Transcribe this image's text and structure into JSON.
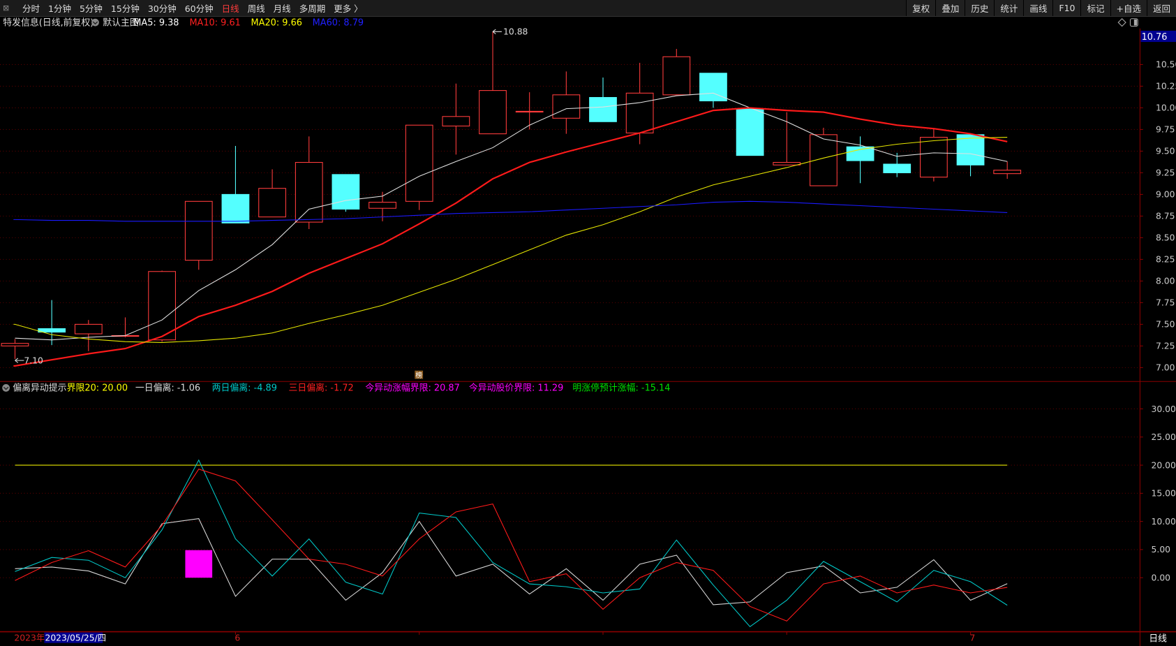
{
  "toolbar": {
    "collapse_icon": "panel-collapse-icon",
    "periods": [
      "分时",
      "1分钟",
      "5分钟",
      "15分钟",
      "30分钟",
      "60分钟",
      "日线",
      "周线",
      "月线",
      "多周期",
      "更多 〉"
    ],
    "active_period": "日线",
    "actions": [
      "复权",
      "叠加",
      "历史",
      "统计",
      "画线",
      "F10",
      "标记",
      "+自选",
      "返回"
    ]
  },
  "main_header": {
    "title": "特发信息(日线,前复权)",
    "selector_icon": "chevron-down-circle-icon",
    "template": "默认主图",
    "ma": [
      {
        "label": "MA5: 9.38",
        "color": "#ffffff"
      },
      {
        "label": "MA10: 9.61",
        "color": "#ff2020"
      },
      {
        "label": "MA20: 9.66",
        "color": "#ffff00"
      },
      {
        "label": "MA60: 8.79",
        "color": "#2020ff"
      }
    ],
    "right_icons": [
      "diamond-icon",
      "panel-toggle-icon"
    ]
  },
  "indicator_header": {
    "title": "偏离异动提示",
    "items": [
      {
        "label": "界限20: 20.00",
        "color": "#ffff00"
      },
      {
        "label": "一日偏离: -1.06",
        "color": "#dddddd"
      },
      {
        "label": "两日偏离: -4.89",
        "color": "#00c8c8"
      },
      {
        "label": "三日偏离: -1.72",
        "color": "#ff2020"
      },
      {
        "label": "今异动涨幅界限: 20.87",
        "color": "#ff00ff"
      },
      {
        "label": "今异动股价界限: 11.29",
        "color": "#ff00ff"
      },
      {
        "label": "明涨停预计涨幅: -15.14",
        "color": "#00e000"
      }
    ]
  },
  "date_bar": {
    "year": "2023年",
    "cursor_date": "2023/05/25/四",
    "month_labels": [
      "6",
      "7"
    ],
    "period": "日线"
  },
  "colors": {
    "up": "#ff3c3c",
    "down": "#54ffff",
    "ma5": "#e0e0e0",
    "ma10": "#ff1a1a",
    "ma20": "#e6e600",
    "ma60": "#1a1aff",
    "grid": "#5a0000",
    "border": "#8b0000",
    "cursor_bg": "#000090"
  },
  "chart_data": [
    {
      "type": "candlestick",
      "ylim": [
        6.9,
        10.9
      ],
      "yticks": [
        "7.00",
        "7.25",
        "7.50",
        "7.75",
        "8.00",
        "8.25",
        "8.50",
        "8.75",
        "9.00",
        "9.25",
        "9.50",
        "9.75",
        "10.00",
        "10.25",
        "10.50"
      ],
      "current_price_label": "10.76",
      "annotations": [
        {
          "label": "10.88",
          "type": "high"
        },
        {
          "label": "7.10",
          "type": "low"
        }
      ],
      "ohlc": [
        [
          7.25,
          7.33,
          7.1,
          7.28
        ],
        [
          7.45,
          7.78,
          7.26,
          7.41
        ],
        [
          7.39,
          7.55,
          7.19,
          7.5
        ],
        [
          7.37,
          7.58,
          7.35,
          7.37
        ],
        [
          7.32,
          8.12,
          7.3,
          8.11
        ],
        [
          8.24,
          8.92,
          8.13,
          8.92
        ],
        [
          9.0,
          9.56,
          8.67,
          8.67
        ],
        [
          8.74,
          9.29,
          8.74,
          9.07
        ],
        [
          8.68,
          9.67,
          8.6,
          9.37
        ],
        [
          9.23,
          9.23,
          8.8,
          8.83
        ],
        [
          8.84,
          9.03,
          8.69,
          8.91
        ],
        [
          8.92,
          9.8,
          8.82,
          9.8
        ],
        [
          9.79,
          10.28,
          9.46,
          9.9
        ],
        [
          9.7,
          10.88,
          9.7,
          10.2
        ],
        [
          9.96,
          10.18,
          9.75,
          9.96
        ],
        [
          9.88,
          10.42,
          9.7,
          10.15
        ],
        [
          10.12,
          10.35,
          9.84,
          9.84
        ],
        [
          9.71,
          10.52,
          9.58,
          10.17
        ],
        [
          10.15,
          10.68,
          10.15,
          10.59
        ],
        [
          10.4,
          10.4,
          10.0,
          10.08
        ],
        [
          9.99,
          10.0,
          9.45,
          9.45
        ],
        [
          9.34,
          9.95,
          9.34,
          9.37
        ],
        [
          9.1,
          9.77,
          9.1,
          9.69
        ],
        [
          9.55,
          9.67,
          9.13,
          9.39
        ],
        [
          9.35,
          9.48,
          9.2,
          9.25
        ],
        [
          9.2,
          9.76,
          9.15,
          9.66
        ],
        [
          9.69,
          9.7,
          9.21,
          9.34
        ],
        [
          9.24,
          9.38,
          9.18,
          9.28
        ]
      ],
      "series": [
        {
          "name": "MA5",
          "values": [
            7.34,
            7.32,
            7.35,
            7.37,
            7.55,
            7.89,
            8.13,
            8.42,
            8.83,
            8.93,
            8.98,
            9.21,
            9.38,
            9.54,
            9.8,
            9.99,
            10.01,
            10.06,
            10.14,
            10.17,
            10.0,
            9.84,
            9.64,
            9.57,
            9.44,
            9.48,
            9.47,
            9.38
          ]
        },
        {
          "name": "MA10",
          "values": [
            7.02,
            7.09,
            7.16,
            7.22,
            7.36,
            7.59,
            7.72,
            7.88,
            8.09,
            8.26,
            8.43,
            8.66,
            8.9,
            9.18,
            9.37,
            9.49,
            9.6,
            9.71,
            9.84,
            9.97,
            10.0,
            9.97,
            9.95,
            9.87,
            9.8,
            9.76,
            9.7,
            9.61
          ]
        },
        {
          "name": "MA20",
          "values": [
            7.5,
            7.38,
            7.33,
            7.3,
            7.29,
            7.31,
            7.34,
            7.4,
            7.51,
            7.61,
            7.72,
            7.87,
            8.02,
            8.19,
            8.36,
            8.53,
            8.65,
            8.8,
            8.97,
            9.11,
            9.21,
            9.31,
            9.42,
            9.52,
            9.58,
            9.62,
            9.65,
            9.66
          ]
        },
        {
          "name": "MA60",
          "values": [
            8.71,
            8.7,
            8.7,
            8.69,
            8.69,
            8.69,
            8.69,
            8.7,
            8.71,
            8.72,
            8.74,
            8.76,
            8.78,
            8.79,
            8.8,
            8.82,
            8.84,
            8.86,
            8.88,
            8.91,
            8.92,
            8.91,
            8.89,
            8.87,
            8.85,
            8.83,
            8.81,
            8.79
          ]
        }
      ]
    },
    {
      "type": "line",
      "ylim": [
        -12,
        33
      ],
      "yticks": [
        "30.00",
        "25.00",
        "20.00",
        "15.00",
        "10.00",
        "5.00",
        "0.00"
      ],
      "series": [
        {
          "name": "界限20",
          "values": [
            20,
            20,
            20,
            20,
            20,
            20,
            20,
            20,
            20,
            20,
            20,
            20,
            20,
            20,
            20,
            20,
            20,
            20,
            20,
            20,
            20,
            20,
            20,
            20,
            20,
            20,
            20,
            20
          ]
        },
        {
          "name": "一日偏离",
          "values": [
            1.6,
            1.9,
            1.2,
            -1.1,
            9.6,
            10.5,
            -3.3,
            3.3,
            3.3,
            -4.0,
            0.9,
            10.0,
            0.3,
            2.4,
            -2.9,
            1.6,
            -4.0,
            2.4,
            4.0,
            -4.8,
            -4.3,
            0.9,
            2.1,
            -2.7,
            -1.7,
            3.2,
            -4.0,
            -1.06
          ]
        },
        {
          "name": "两日偏离",
          "values": [
            1.1,
            3.6,
            3.1,
            0.0,
            8.5,
            20.9,
            6.9,
            0.3,
            6.9,
            -0.8,
            -2.9,
            11.5,
            10.7,
            2.7,
            -1.1,
            -1.6,
            -2.7,
            -2.0,
            6.7,
            -1.3,
            -8.7,
            -4.0,
            2.9,
            -0.7,
            -4.3,
            1.3,
            -0.7,
            -4.89
          ]
        },
        {
          "name": "三日偏离",
          "values": [
            -0.5,
            2.7,
            4.8,
            1.9,
            9.3,
            19.3,
            17.2,
            10.3,
            3.3,
            2.4,
            0.3,
            6.9,
            11.7,
            13.1,
            -0.7,
            0.7,
            -5.6,
            0.0,
            2.7,
            1.3,
            -5.1,
            -7.7,
            -1.1,
            0.3,
            -2.7,
            -1.3,
            -2.7,
            -1.72
          ]
        }
      ],
      "bars": [
        {
          "index": 5,
          "value": 4.9,
          "color": "#ff00ff"
        }
      ]
    }
  ]
}
